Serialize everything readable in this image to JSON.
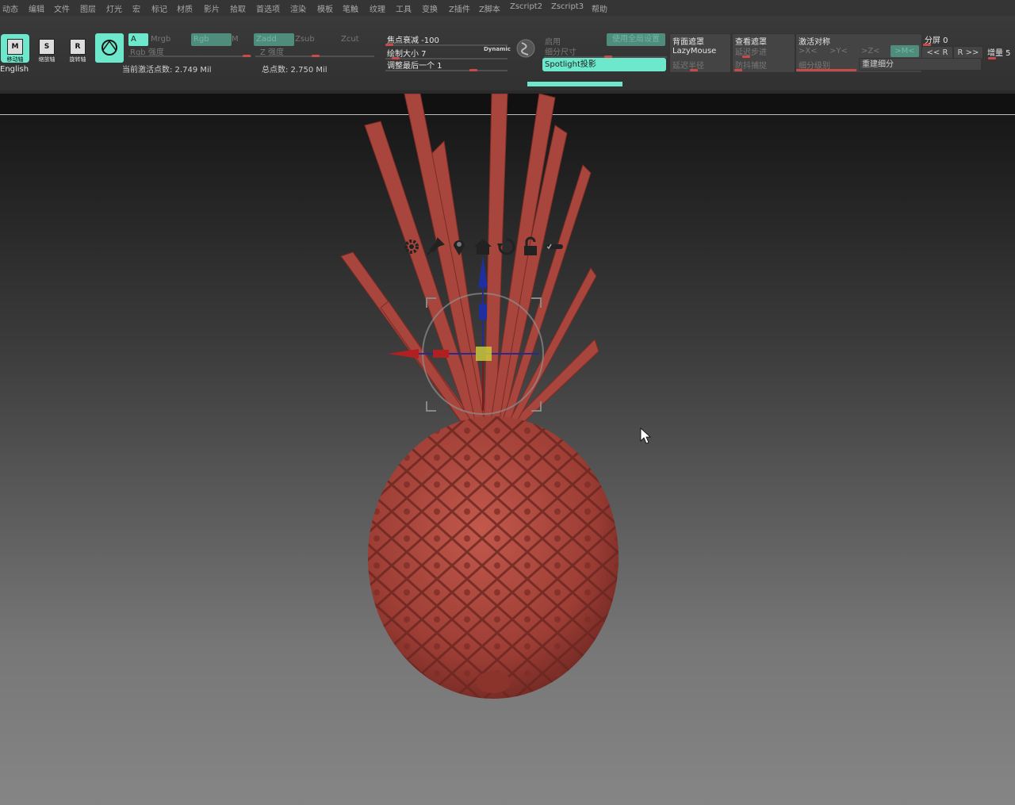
{
  "menu": [
    "动态",
    "编辑",
    "文件",
    "图层",
    "灯光",
    "宏",
    "标记",
    "材质",
    "影片",
    "拾取",
    "首选项",
    "渲染",
    "模板",
    "笔触",
    "纹理",
    "工具",
    "变换",
    "Z插件",
    "Z脚本",
    "Zscript2",
    "Zscript3",
    "帮助"
  ],
  "toolbar": {
    "mode_buttons": [
      {
        "key": "M",
        "label": "移动轴"
      },
      {
        "key": "S",
        "label": "缩放轴"
      },
      {
        "key": "R",
        "label": "旋转轴"
      }
    ],
    "a_label": "A",
    "mrgb": "Mrgb",
    "rgb": "Rgb",
    "m": "M",
    "rgb_intensity": "Rgb 强度",
    "zadd": "Zadd",
    "zsub": "Zsub",
    "zcut": "Zcut",
    "z_intensity": "Z 强度",
    "language": "English",
    "active_points": "当前激活点数: 2.749 Mil",
    "total_points": "总点数: 2.750 Mil",
    "focal_shift": "焦点衰减 -100",
    "draw_size": "绘制大小 7",
    "dynamic": "Dynamic",
    "adjust_last": "调整最后一个 1",
    "enable": "启用",
    "subdiv_size": "细分尺寸",
    "use_global": "使用全局设置",
    "spotlight": "Spotlight投影",
    "backface_mask": "背面遮罩",
    "lazymouse": "LazyMouse",
    "lazy_step": "延迟步进",
    "lazy_radius": "延迟半径",
    "view_mask": "查看遮罩",
    "snap": "防抖捕捉",
    "activate_symmetry": "激活对称",
    "x_sym": ">X<",
    "y_sym": ">Y<",
    "z_sym": ">Z<",
    "m_sym": ">M<",
    "subdiv_level": "细分级别",
    "split_screen": "分屏 0",
    "r_left": "<< R",
    "r_right": "R >>",
    "rebuild_subdiv": "重建细分",
    "increment": "增量 5"
  },
  "colors": {
    "accent": "#6ee8cd",
    "model": "#a8453c",
    "slider_knob": "#c84a4a"
  },
  "gizmo_icons": [
    "gear-icon",
    "pin-icon",
    "location-pin-icon",
    "home-icon",
    "reset-icon",
    "lock-icon",
    "toggle-icon"
  ]
}
